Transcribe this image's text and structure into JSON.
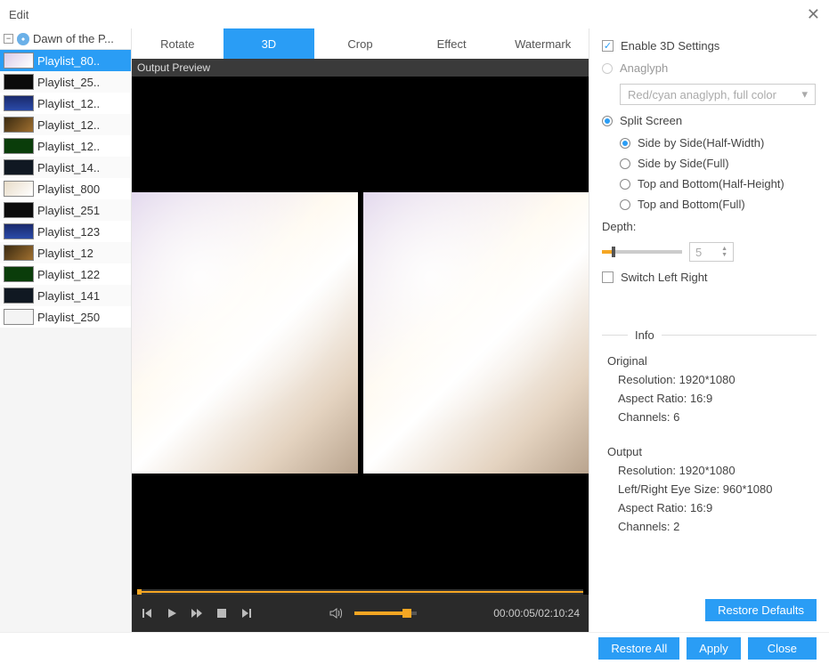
{
  "window": {
    "title": "Edit"
  },
  "tree": {
    "root_label": "Dawn of the P..."
  },
  "playlist": [
    {
      "label": "Playlist_80..",
      "selected": true,
      "thumb": "linear-gradient(135deg,#d9cbe8,#fff)"
    },
    {
      "label": "Playlist_25..",
      "selected": false,
      "thumb": "#0b0b0b"
    },
    {
      "label": "Playlist_12..",
      "selected": false,
      "thumb": "linear-gradient(#1a2a6c,#2a4aa8)"
    },
    {
      "label": "Playlist_12..",
      "selected": false,
      "thumb": "linear-gradient(135deg,#3a2a10,#a07030)"
    },
    {
      "label": "Playlist_12..",
      "selected": false,
      "thumb": "#0a3d0a"
    },
    {
      "label": "Playlist_14..",
      "selected": false,
      "thumb": "#101822"
    },
    {
      "label": "Playlist_800",
      "selected": false,
      "thumb": "linear-gradient(135deg,#e8dcc8,#fff)"
    },
    {
      "label": "Playlist_251",
      "selected": false,
      "thumb": "#0b0b0b"
    },
    {
      "label": "Playlist_123",
      "selected": false,
      "thumb": "linear-gradient(#1a2a6c,#2a4aa8)"
    },
    {
      "label": "Playlist_12",
      "selected": false,
      "thumb": "linear-gradient(135deg,#3a2a10,#a07030)"
    },
    {
      "label": "Playlist_122",
      "selected": false,
      "thumb": "#0a3d0a"
    },
    {
      "label": "Playlist_141",
      "selected": false,
      "thumb": "#101822"
    },
    {
      "label": "Playlist_250",
      "selected": false,
      "thumb": "#f4f4f4"
    }
  ],
  "tabs": [
    {
      "label": "Rotate",
      "active": false
    },
    {
      "label": "3D",
      "active": true
    },
    {
      "label": "Crop",
      "active": false
    },
    {
      "label": "Effect",
      "active": false
    },
    {
      "label": "Watermark",
      "active": false
    }
  ],
  "preview": {
    "label": "Output Preview",
    "time_current": "00:00:05",
    "time_total": "02:10:24"
  },
  "settings3d": {
    "enable_label": "Enable 3D Settings",
    "enable_checked": true,
    "anaglyph_label": "Anaglyph",
    "anaglyph_selected": false,
    "anaglyph_option": "Red/cyan anaglyph, full color",
    "split_label": "Split Screen",
    "split_selected": true,
    "split_options": [
      {
        "label": "Side by Side(Half-Width)",
        "selected": true
      },
      {
        "label": "Side by Side(Full)",
        "selected": false
      },
      {
        "label": "Top and Bottom(Half-Height)",
        "selected": false
      },
      {
        "label": "Top and Bottom(Full)",
        "selected": false
      }
    ],
    "depth_label": "Depth:",
    "depth_value": "5",
    "switch_label": "Switch Left Right",
    "switch_checked": false
  },
  "info": {
    "heading": "Info",
    "original": {
      "title": "Original",
      "resolution_label": "Resolution:",
      "resolution": "1920*1080",
      "aspect_label": "Aspect Ratio:",
      "aspect": "16:9",
      "channels_label": "Channels:",
      "channels": "6"
    },
    "output": {
      "title": "Output",
      "resolution_label": "Resolution:",
      "resolution": "1920*1080",
      "eyesize_label": "Left/Right Eye Size:",
      "eyesize": "960*1080",
      "aspect_label": "Aspect Ratio:",
      "aspect": "16:9",
      "channels_label": "Channels:",
      "channels": "2"
    }
  },
  "buttons": {
    "restore_defaults": "Restore Defaults",
    "restore_all": "Restore All",
    "apply": "Apply",
    "close": "Close"
  }
}
